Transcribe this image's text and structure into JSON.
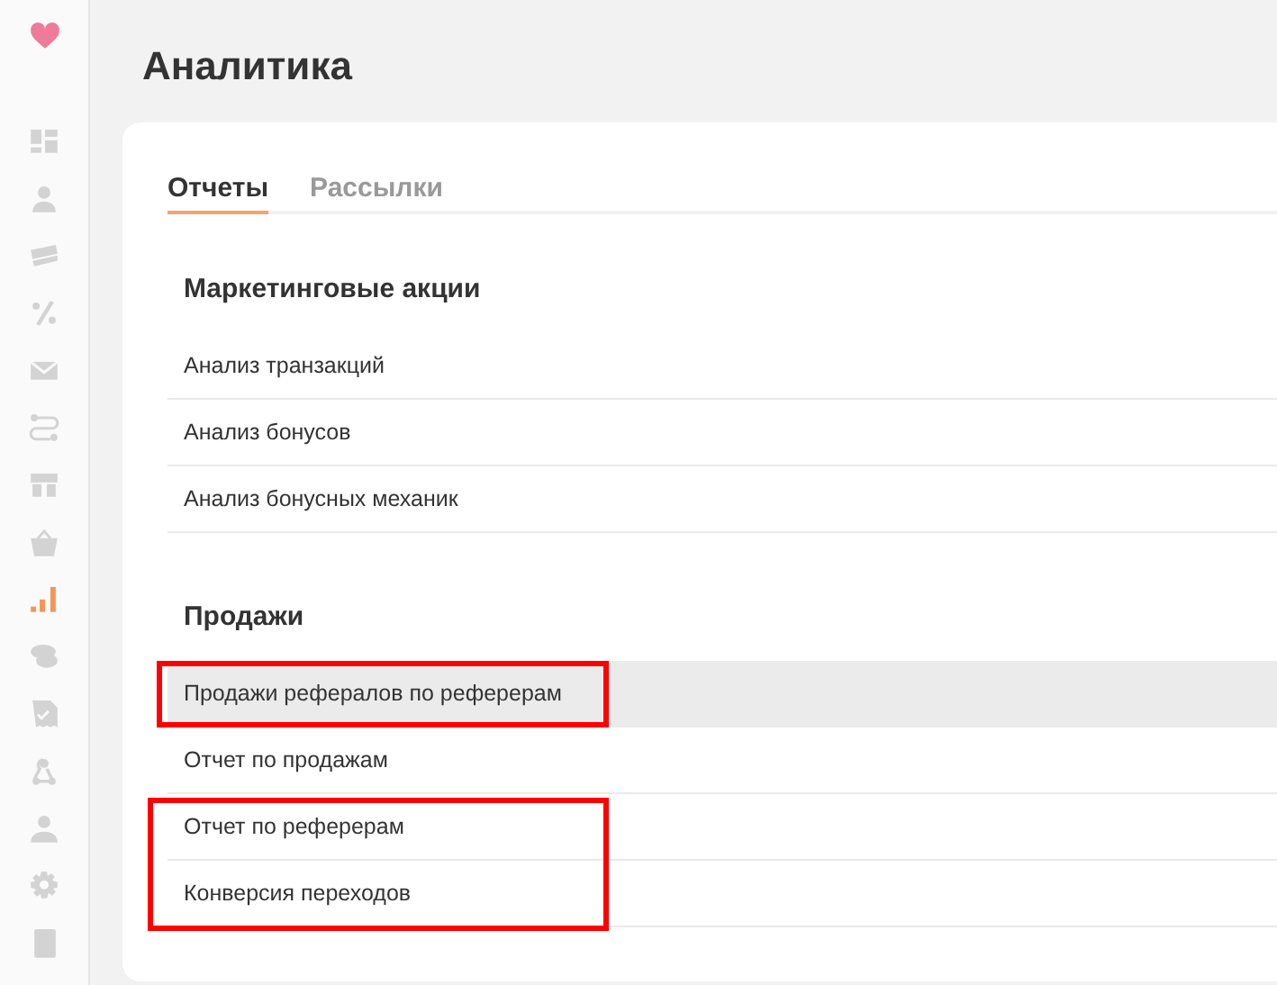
{
  "sidebar": {
    "items": [
      {
        "selected": false
      },
      {
        "selected": false
      },
      {
        "selected": false
      },
      {
        "selected": false
      },
      {
        "selected": false
      },
      {
        "selected": false
      },
      {
        "selected": false
      },
      {
        "selected": false
      },
      {
        "selected": true
      },
      {
        "selected": false
      },
      {
        "selected": false
      },
      {
        "selected": false
      },
      {
        "selected": false
      },
      {
        "selected": false
      },
      {
        "selected": false
      }
    ]
  },
  "page": {
    "title": "Аналитика"
  },
  "tabs": [
    {
      "label": "Отчеты",
      "selected": true
    },
    {
      "label": "Рассылки",
      "selected": false
    }
  ],
  "sections": [
    {
      "title": "Маркетинговые акции",
      "groups": [
        {
          "highlighted": false,
          "items": [
            {
              "label": "Анализ транзакций",
              "hovered": false
            },
            {
              "label": "Анализ бонусов",
              "hovered": false
            },
            {
              "label": "Анализ бонусных механик",
              "hovered": false
            }
          ]
        }
      ]
    },
    {
      "title": "Продажи",
      "groups": [
        {
          "highlighted": true,
          "items": [
            {
              "label": "Продажи рефералов по реферерам",
              "hovered": true
            }
          ]
        },
        {
          "highlighted": false,
          "items": [
            {
              "label": "Отчет по продажам",
              "hovered": false
            }
          ]
        },
        {
          "highlighted": true,
          "items": [
            {
              "label": "Отчет по реферерам",
              "hovered": false
            },
            {
              "label": "Конверсия переходов",
              "hovered": false
            }
          ]
        }
      ]
    }
  ]
}
